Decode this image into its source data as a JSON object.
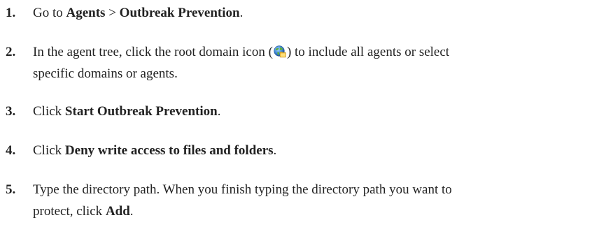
{
  "steps": [
    {
      "number": "1.",
      "parts": {
        "a": "Go to ",
        "b": "Agents",
        "c": " > ",
        "d": "Outbreak Prevention",
        "e": "."
      }
    },
    {
      "number": "2.",
      "parts": {
        "a": "In the agent tree, click the root domain icon (",
        "icon": "globe-folder-icon",
        "b": ") to include all agents or select",
        "c": "specific domains or agents."
      }
    },
    {
      "number": "3.",
      "parts": {
        "a": "Click ",
        "b": "Start Outbreak Prevention",
        "c": "."
      }
    },
    {
      "number": "4.",
      "parts": {
        "a": "Click ",
        "b": "Deny write access to files and folders",
        "c": "."
      }
    },
    {
      "number": "5.",
      "parts": {
        "a": "Type the directory path. When you finish typing the directory path you want to",
        "b": "protect, click ",
        "c": "Add",
        "d": "."
      }
    }
  ]
}
